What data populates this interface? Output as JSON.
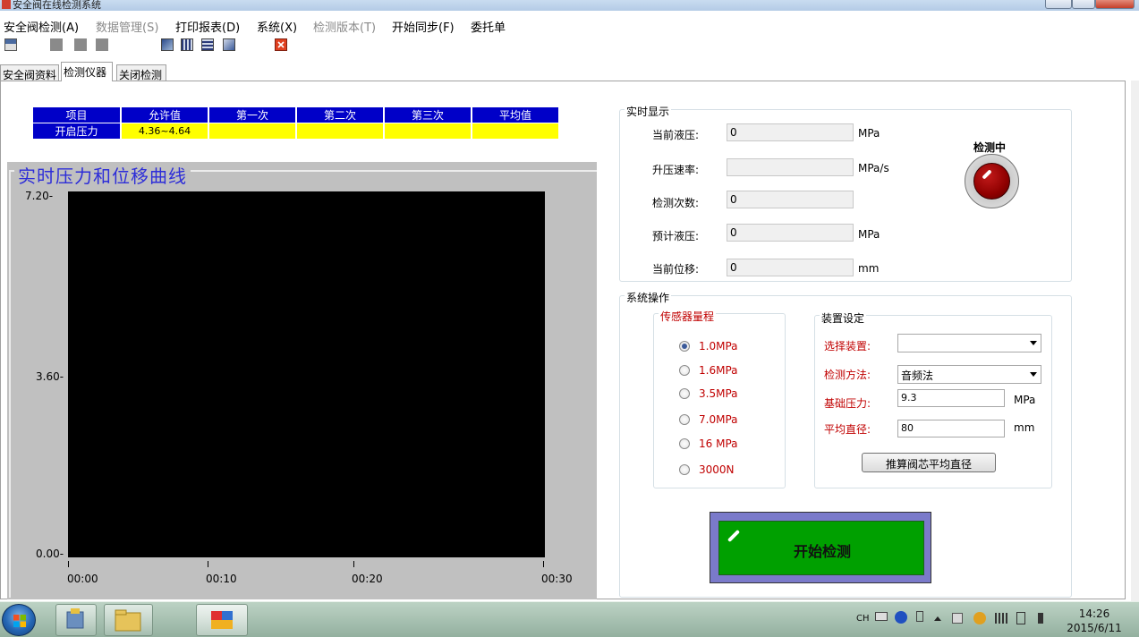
{
  "window": {
    "title": "安全阀在线检测系统"
  },
  "menu": {
    "items": [
      {
        "label": "安全阀检测(A)",
        "enabled": true
      },
      {
        "label": "数据管理(S)",
        "enabled": false
      },
      {
        "label": "打印报表(D)",
        "enabled": true
      },
      {
        "label": "系统(X)",
        "enabled": true
      },
      {
        "label": "检测版本(T)",
        "enabled": false
      },
      {
        "label": "开始同步(F)",
        "enabled": true
      },
      {
        "label": "委托单",
        "enabled": true
      }
    ]
  },
  "tabs": [
    {
      "label": "安全阀资料",
      "active": false
    },
    {
      "label": "检测仪器",
      "active": true
    },
    {
      "label": "关闭检测",
      "active": false
    }
  ],
  "result_table": {
    "headers": [
      "项目",
      "允许值",
      "第一次",
      "第二次",
      "第三次",
      "平均值"
    ],
    "row": [
      "开启压力",
      "4.36~4.64",
      "",
      "",
      "",
      ""
    ]
  },
  "chart_data": {
    "type": "line",
    "title": "实时压力和位移曲线",
    "y_ticks": [
      "7.20-",
      "3.60-",
      "0.00-"
    ],
    "x_ticks": [
      "00:00",
      "00:10",
      "00:20",
      "00:30"
    ],
    "ylim": [
      0,
      7.2
    ],
    "series": [],
    "background": "#000000"
  },
  "realtime": {
    "title": "实时显示",
    "fields": [
      {
        "label": "当前液压:",
        "value": "0",
        "unit": "MPa"
      },
      {
        "label": "升压速率:",
        "value": "",
        "unit": "MPa/s"
      },
      {
        "label": "检测次数:",
        "value": "0",
        "unit": ""
      },
      {
        "label": "预计液压:",
        "value": "0",
        "unit": "MPa"
      },
      {
        "label": "当前位移:",
        "value": "0",
        "unit": "mm"
      }
    ],
    "status_label": "检测中",
    "status_color": "#8f0000"
  },
  "system_ops": {
    "title": "系统操作",
    "sensor_range": {
      "title": "传感器量程",
      "options": [
        "1.0MPa",
        "1.6MPa",
        "3.5MPa",
        "7.0MPa",
        "16 MPa",
        "3000N"
      ],
      "selected": "1.0MPa"
    },
    "device_settings": {
      "title": "装置设定",
      "select_device_label": "选择装置:",
      "select_device_value": "",
      "method_label": "检测方法:",
      "method_value": "音频法",
      "base_pressure_label": "基础压力:",
      "base_pressure_value": "9.3",
      "base_pressure_unit": "MPa",
      "avg_diameter_label": "平均直径:",
      "avg_diameter_value": "80",
      "avg_diameter_unit": "mm",
      "calc_button": "推算阀芯平均直径"
    },
    "start_button": "开始检测"
  },
  "taskbar": {
    "tray_lang": "CH",
    "clock_time": "14:26",
    "clock_date": "2015/6/11"
  }
}
